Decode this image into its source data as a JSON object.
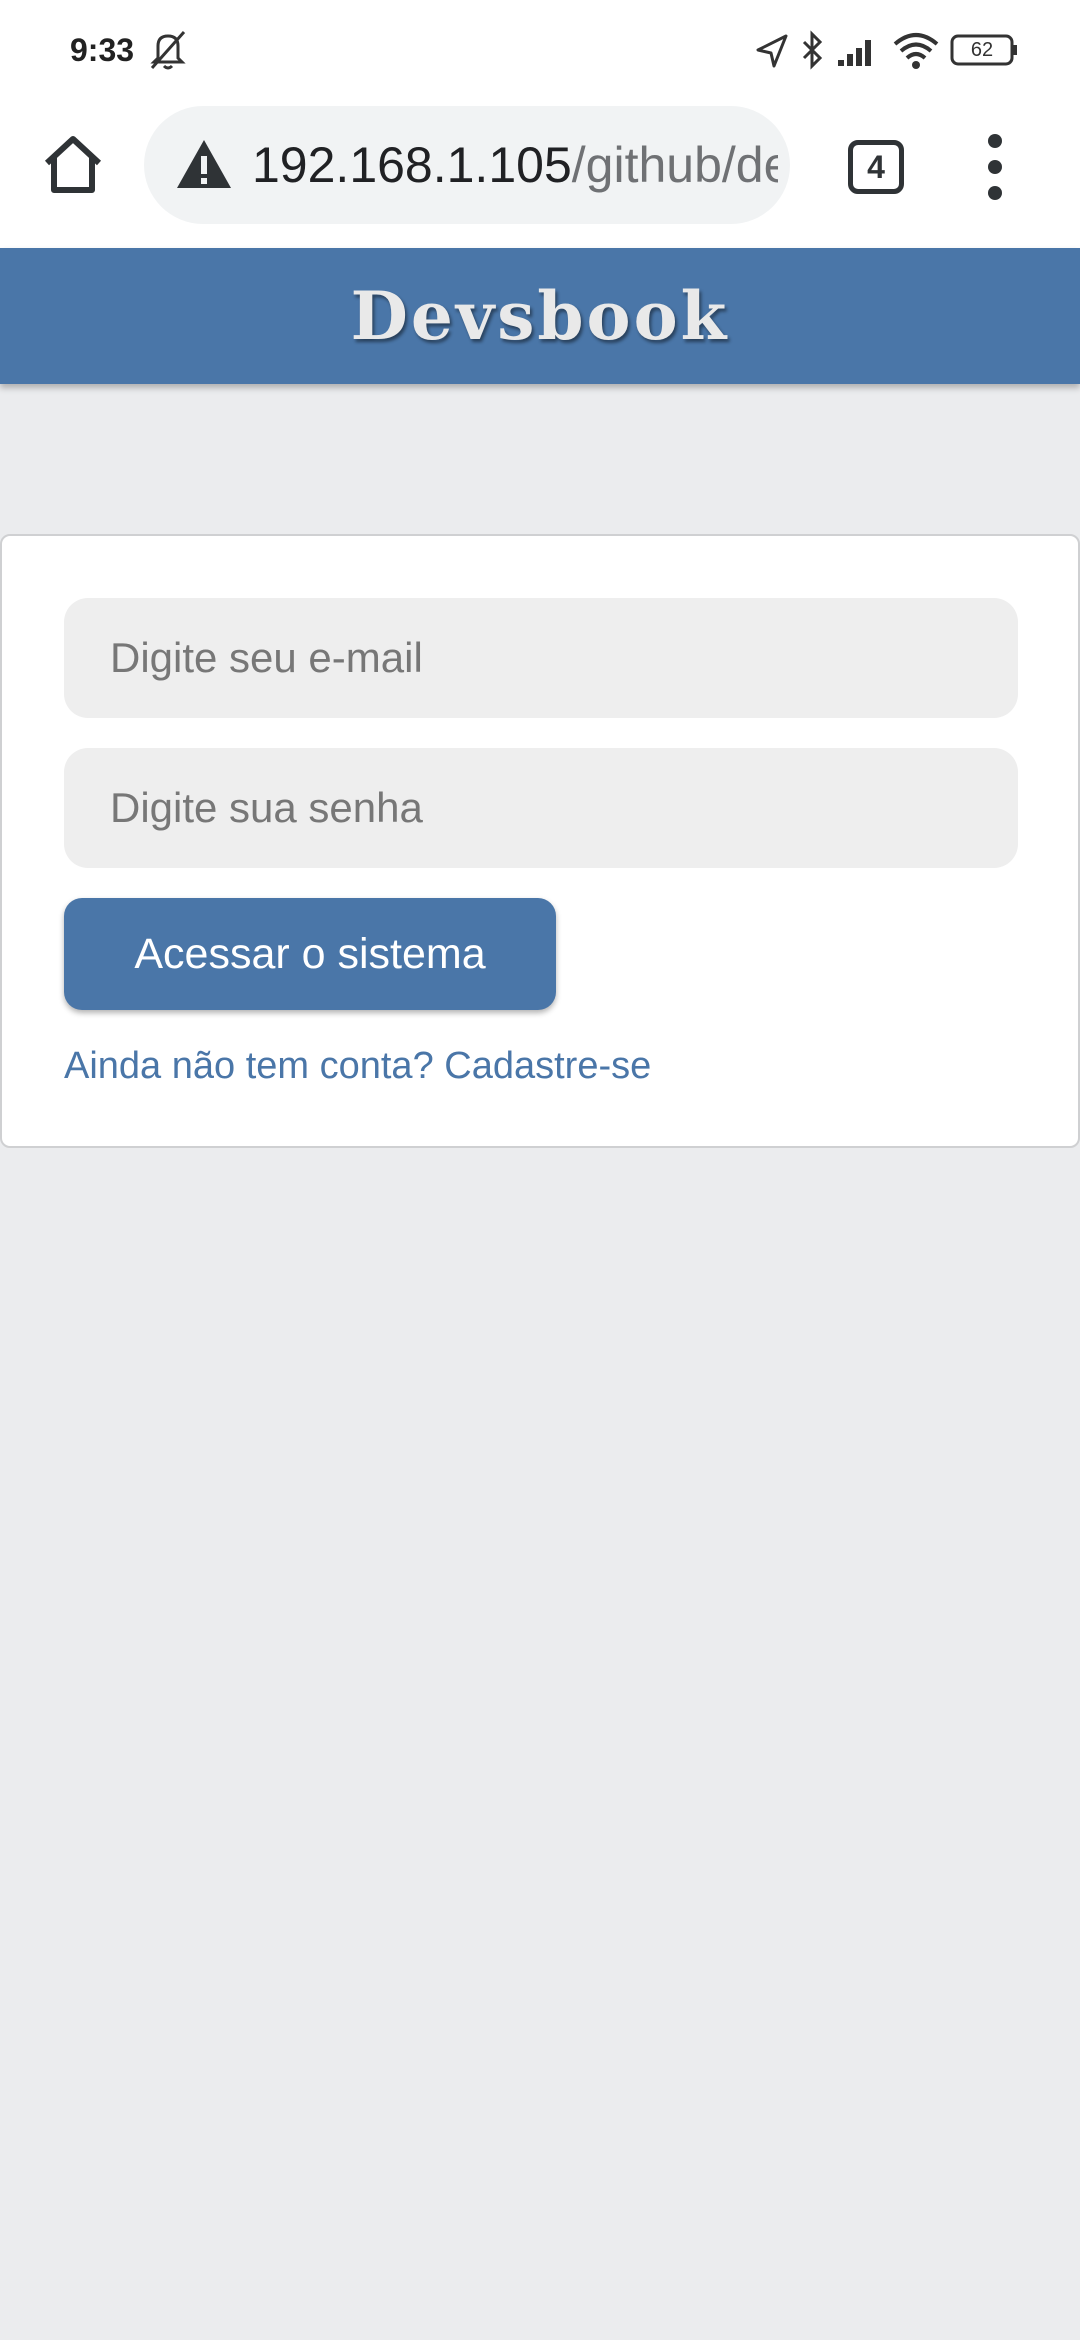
{
  "status_bar": {
    "time": "9:33",
    "battery": "62",
    "icons": [
      "mute-bell-icon",
      "location-arrow-icon",
      "bluetooth-icon",
      "signal-icon",
      "wifi-icon",
      "battery-icon"
    ]
  },
  "browser": {
    "url_host": "192.168.1.105",
    "url_path": "/github/de",
    "tab_count": "4",
    "icons": [
      "home-icon",
      "warning-icon",
      "tabs-icon",
      "menu-icon"
    ]
  },
  "app": {
    "title": "Devsbook",
    "header_color": "#4a76a8"
  },
  "login": {
    "email_placeholder": "Digite seu e-mail",
    "password_placeholder": "Digite sua senha",
    "submit_label": "Acessar o sistema",
    "signup_link": "Ainda não tem conta? Cadastre-se"
  }
}
